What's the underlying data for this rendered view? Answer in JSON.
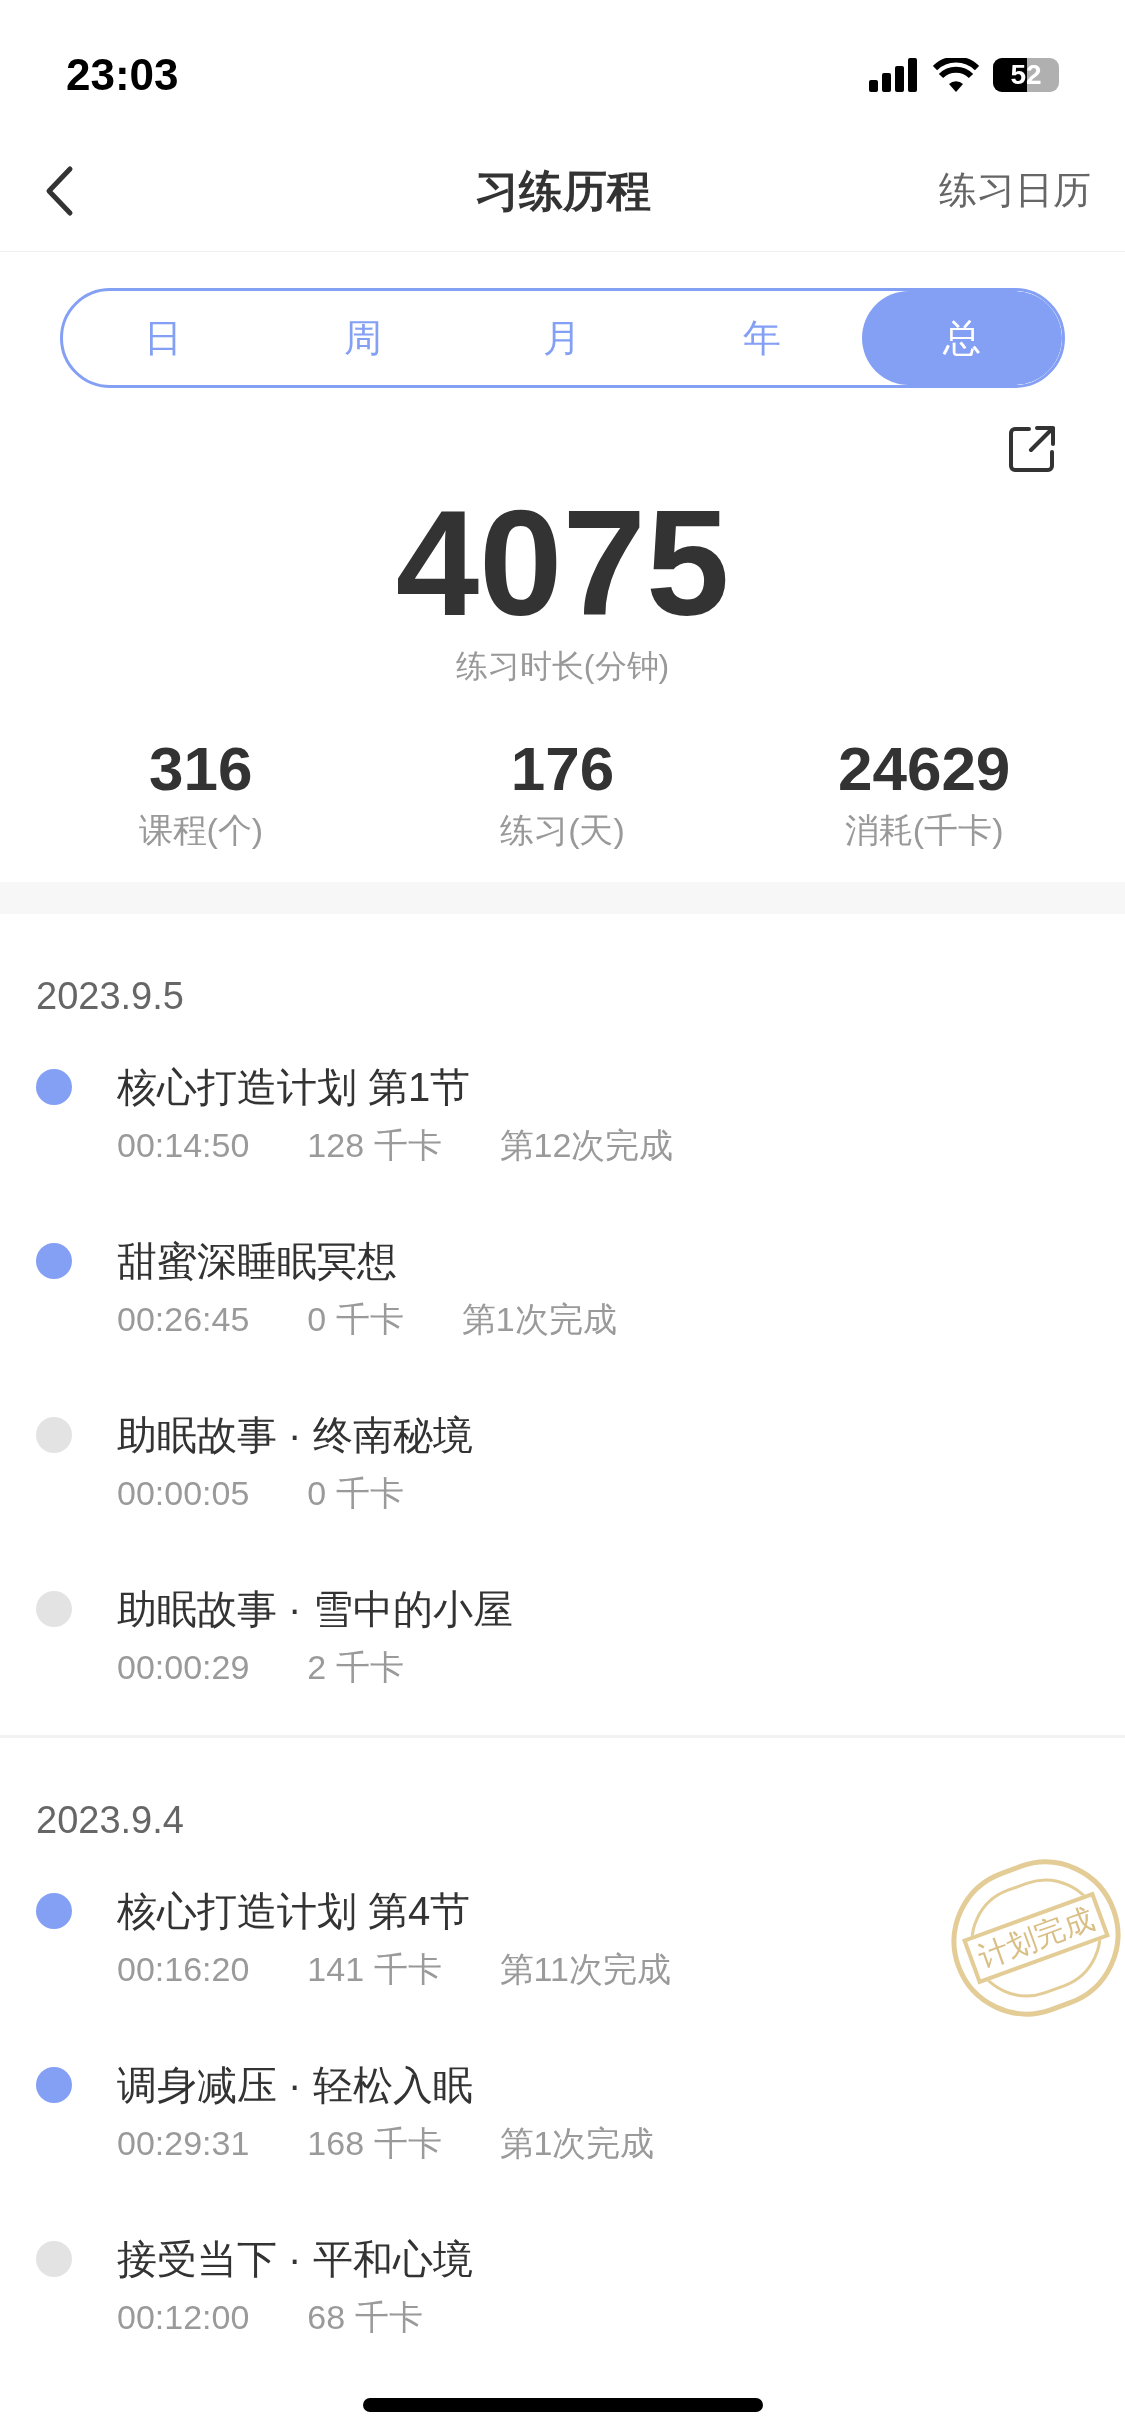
{
  "status_bar": {
    "time": "23:03",
    "battery": "52"
  },
  "nav": {
    "title": "习练历程",
    "action": "练习日历"
  },
  "tabs": [
    {
      "label": "日",
      "selected": false
    },
    {
      "label": "周",
      "selected": false
    },
    {
      "label": "月",
      "selected": false
    },
    {
      "label": "年",
      "selected": false
    },
    {
      "label": "总",
      "selected": true
    }
  ],
  "summary": {
    "value": "4075",
    "label": "练习时长(分钟)"
  },
  "stats": [
    {
      "value": "316",
      "label": "课程(个)"
    },
    {
      "value": "176",
      "label": "练习(天)"
    },
    {
      "value": "24629",
      "label": "消耗(千卡)"
    }
  ],
  "days": [
    {
      "date": "2023.9.5",
      "items": [
        {
          "title": "核心打造计划 第1节",
          "duration": "00:14:50",
          "calories": "128 千卡",
          "count": "第12次完成",
          "completed": true
        },
        {
          "title": "甜蜜深睡眠冥想",
          "duration": "00:26:45",
          "calories": "0 千卡",
          "count": "第1次完成",
          "completed": true
        },
        {
          "title": "助眠故事 · 终南秘境",
          "duration": "00:00:05",
          "calories": "0 千卡",
          "completed": false
        },
        {
          "title": "助眠故事 · 雪中的小屋",
          "duration": "00:00:29",
          "calories": "2 千卡",
          "completed": false
        }
      ]
    },
    {
      "date": "2023.9.4",
      "items": [
        {
          "title": "核心打造计划 第4节",
          "duration": "00:16:20",
          "calories": "141 千卡",
          "count": "第11次完成",
          "completed": true,
          "stamp": "计划完成"
        },
        {
          "title": "调身减压 · 轻松入眠",
          "duration": "00:29:31",
          "calories": "168 千卡",
          "count": "第1次完成",
          "completed": true
        },
        {
          "title": "接受当下 · 平和心境",
          "duration": "00:12:00",
          "calories": "68 千卡",
          "completed": false
        }
      ]
    }
  ]
}
